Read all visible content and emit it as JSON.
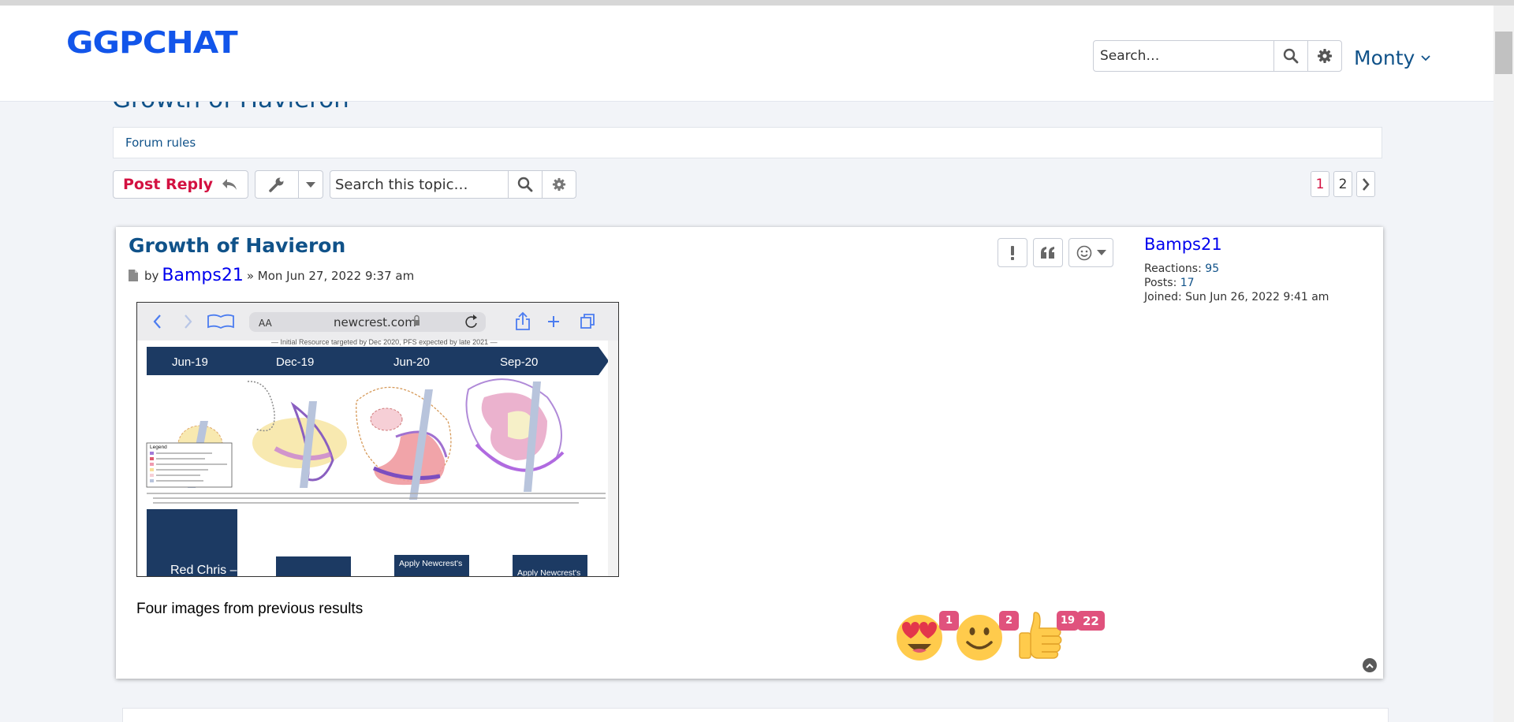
{
  "site": {
    "logo": "GGPCHAT"
  },
  "header": {
    "search_placeholder": "Search…",
    "username": "Monty"
  },
  "topic": {
    "title": "Growth of Havieron",
    "forum_rules": "Forum rules",
    "post_reply": "Post Reply",
    "search_placeholder": "Search this topic…",
    "pages": [
      "1",
      "2"
    ],
    "current_page": "1"
  },
  "post": {
    "title": "Growth of Havieron",
    "by": "by",
    "author": "Bamps21",
    "date": "» Mon Jun 27, 2022 9:37 am",
    "content": "Four images from previous results",
    "attachment": {
      "url_label": "newcrest.com",
      "font_size_label": "AA",
      "timeline": [
        "Jun-19",
        "Dec-19",
        "Jun-20",
        "Sep-20"
      ],
      "legend_title": "Legend",
      "bottom_labels": [
        "Red Chris –",
        "Apply Newcrest's",
        "Apply Newcrest's"
      ]
    },
    "reactions": [
      {
        "icon": "heart-eyes-emoji-icon",
        "count": "1"
      },
      {
        "icon": "smiley-emoji-icon",
        "count": "2"
      },
      {
        "icon": "thumbs-up-emoji-icon",
        "count": "19"
      }
    ],
    "reactions_total": "22"
  },
  "profile": {
    "name": "Bamps21",
    "reactions_label": "Reactions:",
    "reactions_value": "95",
    "posts_label": "Posts:",
    "posts_value": "17",
    "joined_label": "Joined:",
    "joined_value": "Sun Jun 26, 2022 9:41 am"
  },
  "colors": {
    "brand": "#1255ea",
    "link": "#105289",
    "accent": "#d31141",
    "badge": "#e0527d"
  }
}
